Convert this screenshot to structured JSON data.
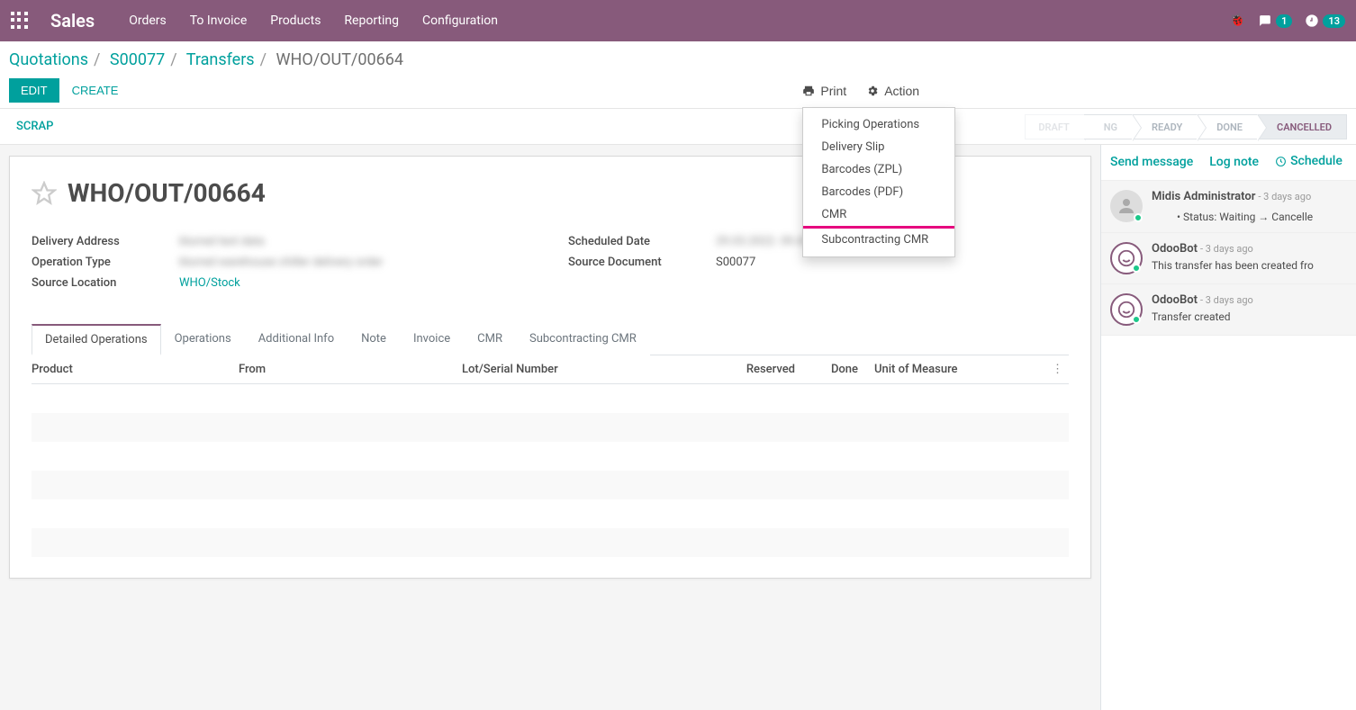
{
  "topbar": {
    "brand": "Sales",
    "menu": [
      "Orders",
      "To Invoice",
      "Products",
      "Reporting",
      "Configuration"
    ],
    "msg_badge": "1",
    "activity_badge": "13"
  },
  "breadcrumb": {
    "items": [
      "Quotations",
      "S00077",
      "Transfers"
    ],
    "current": "WHO/OUT/00664"
  },
  "buttons": {
    "edit": "EDIT",
    "create": "CREATE",
    "print": "Print",
    "action": "Action",
    "scrap": "SCRAP"
  },
  "print_menu": [
    "Picking Operations",
    "Delivery Slip",
    "Barcodes (ZPL)",
    "Barcodes (PDF)",
    "CMR",
    "Subcontracting CMR"
  ],
  "status_steps": [
    "DRAFT",
    "WAITING",
    "READY",
    "DONE",
    "CANCELLED"
  ],
  "status_active_index": 4,
  "document": {
    "title": "WHO/OUT/00664",
    "fields_left": [
      {
        "label": "Delivery Address",
        "value": "blurred text data",
        "blur": true
      },
      {
        "label": "Operation Type",
        "value": "blurred warehouse chiller delivery order",
        "blur": true
      },
      {
        "label": "Source Location",
        "value": "WHO/Stock",
        "teal": true
      }
    ],
    "fields_right": [
      {
        "label": "Scheduled Date",
        "value": "29.03.2022. 09.43.30",
        "blur": true
      },
      {
        "label": "Source Document",
        "value": "S00077"
      }
    ]
  },
  "tabs": [
    "Detailed Operations",
    "Operations",
    "Additional Info",
    "Note",
    "Invoice",
    "CMR",
    "Subcontracting CMR"
  ],
  "active_tab": 0,
  "columns": {
    "product": "Product",
    "from": "From",
    "lot": "Lot/Serial Number",
    "reserved": "Reserved",
    "done": "Done",
    "uom": "Unit of Measure"
  },
  "chatter": {
    "send": "Send message",
    "log": "Log note",
    "schedule": "Schedule",
    "messages": [
      {
        "author": "Midis Administrator",
        "time": "- 3 days ago",
        "bullet": "Status: Waiting → Cancelle",
        "avatar": "grey"
      },
      {
        "author": "OdooBot",
        "time": "- 3 days ago",
        "text": "This transfer has been created fro",
        "avatar": "bot"
      },
      {
        "author": "OdooBot",
        "time": "- 3 days ago",
        "text": "Transfer created",
        "avatar": "bot"
      }
    ]
  }
}
